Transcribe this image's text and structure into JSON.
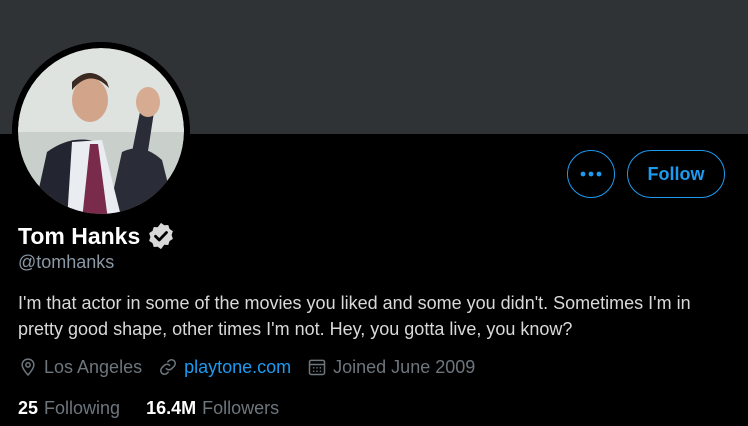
{
  "profile": {
    "name": "Tom Hanks",
    "handle": "@tomhanks",
    "bio": "I'm that actor in some of the movies you liked and some you didn't. Sometimes I'm in pretty good shape, other times I'm not. Hey, you gotta live, you know?",
    "location": "Los Angeles",
    "website": "playtone.com",
    "joined": "Joined June 2009"
  },
  "actions": {
    "follow_label": "Follow",
    "more_icon": "more-horizontal-icon"
  },
  "stats": {
    "following_count": "25",
    "following_label": "Following",
    "followers_count": "16.4M",
    "followers_label": "Followers"
  },
  "colors": {
    "background": "#000000",
    "banner": "#2f3336",
    "accent": "#1d9bf0",
    "text_primary": "#ffffff",
    "text_secondary": "#6e767d"
  },
  "icons": {
    "verified": "verified-badge-icon",
    "location": "location-pin-icon",
    "link": "link-icon",
    "calendar": "calendar-icon"
  }
}
